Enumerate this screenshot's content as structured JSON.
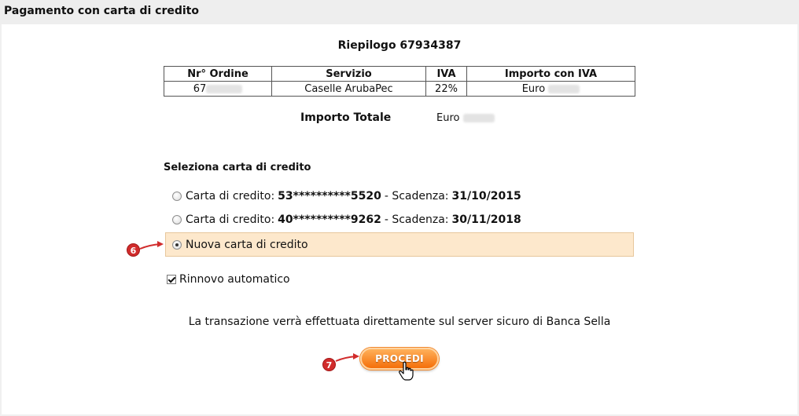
{
  "header": {
    "title": "Pagamento con carta di credito"
  },
  "summary": {
    "title": "Riepilogo 67934387",
    "columns": [
      "Nr° Ordine",
      "Servizio",
      "IVA",
      "Importo con IVA"
    ],
    "row": {
      "order_prefix": "67",
      "service": "Caselle ArubaPec",
      "iva": "22%",
      "amount_prefix": "Euro"
    },
    "total_label": "Importo Totale",
    "total_prefix": "Euro"
  },
  "selection": {
    "title": "Seleziona carta di credito",
    "card_label": "Carta di credito:",
    "expiry_label": "- Scadenza:",
    "cards": [
      {
        "number": "53**********5520",
        "expiry": "31/10/2015",
        "selected": false
      },
      {
        "number": "40**********9262",
        "expiry": "30/11/2018",
        "selected": false
      }
    ],
    "new_card_label": "Nuova carta di credito",
    "new_card_selected": true
  },
  "auto_renew": {
    "label": "Rinnovo automatico",
    "checked": true
  },
  "notice": "La transazione verrà effettuata direttamente sul server sicuro di Banca Sella",
  "actions": {
    "submit_label": "PROCEDI"
  },
  "annotations": {
    "step_new_card": "6",
    "step_submit": "7"
  },
  "colors": {
    "highlight": "#fde8cc",
    "button": "#f46f0a",
    "badge": "#d12c2c"
  }
}
